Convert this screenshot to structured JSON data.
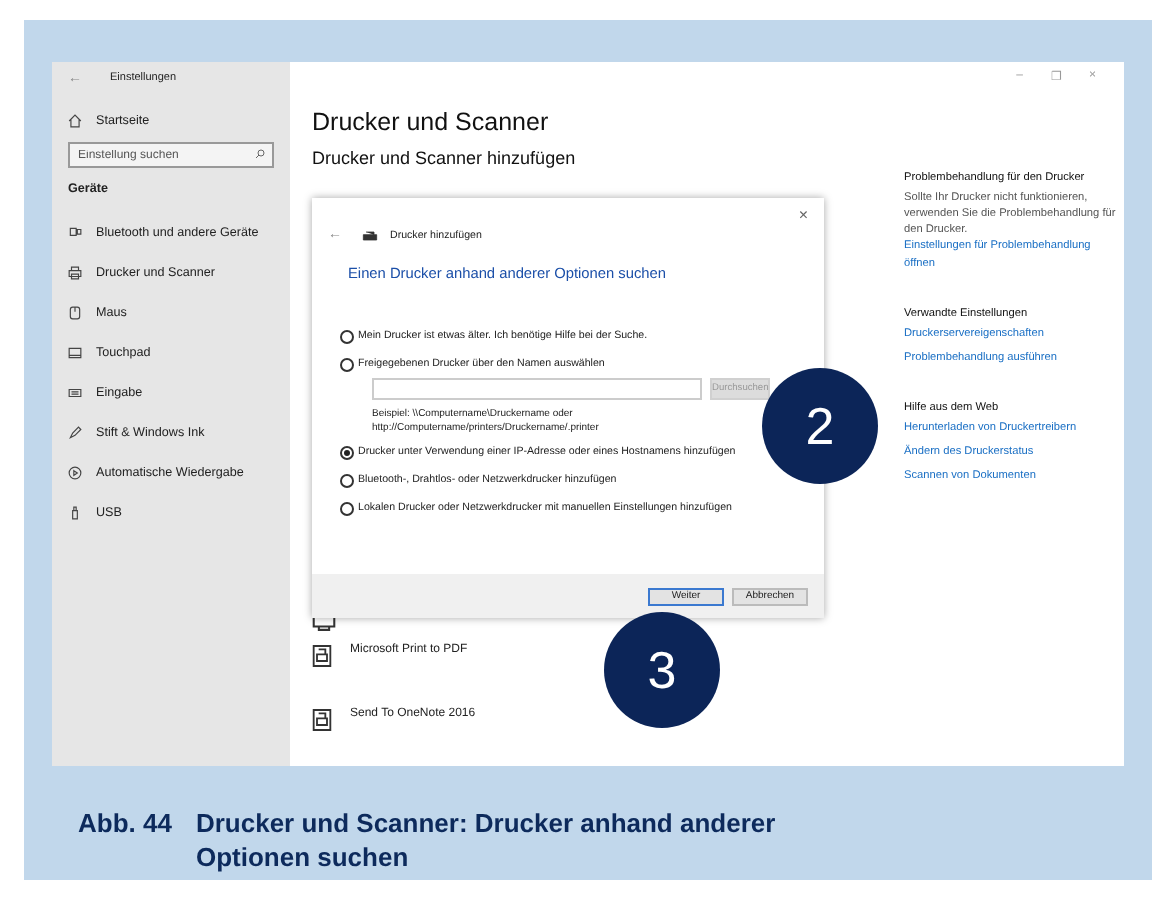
{
  "window": {
    "back": "←",
    "title": "Einstellungen",
    "controls": [
      "–",
      "❐",
      "×"
    ]
  },
  "sidebar": {
    "home": "Startseite",
    "search": {
      "placeholder": "Einstellung suchen"
    },
    "section": "Geräte",
    "items": [
      {
        "label": "Bluetooth und andere Geräte"
      },
      {
        "label": "Drucker und Scanner"
      },
      {
        "label": "Maus"
      },
      {
        "label": "Touchpad"
      },
      {
        "label": "Eingabe"
      },
      {
        "label": "Stift & Windows Ink"
      },
      {
        "label": "Automatische Wiedergabe"
      },
      {
        "label": "USB"
      }
    ]
  },
  "main": {
    "title": "Drucker und Scanner",
    "subtitle": "Drucker und Scanner hinzufügen",
    "printers": [
      "Microsoft Print to PDF",
      "Send To OneNote 2016"
    ]
  },
  "dialog": {
    "close": "×",
    "back": "←",
    "title": "Drucker hinzufügen",
    "heading": "Einen Drucker anhand anderer Optionen suchen",
    "options": [
      {
        "label": "Mein Drucker ist etwas älter. Ich benötige Hilfe bei der Suche.",
        "selected": false
      },
      {
        "label": "Freigegebenen Drucker über den Namen auswählen",
        "selected": false
      },
      {
        "label": "Drucker unter Verwendung einer IP-Adresse oder eines Hostnamens hinzufügen",
        "selected": true
      },
      {
        "label": "Bluetooth-, Drahtlos- oder Netzwerkdrucker hinzufügen",
        "selected": false
      },
      {
        "label": "Lokalen Drucker oder Netzwerkdrucker mit manuellen Einstellungen hinzufügen",
        "selected": false
      }
    ],
    "browse_button": {
      "label": "Durchsuchen",
      "disabled": true
    },
    "example": [
      "Beispiel: \\\\Computername\\Druckername oder",
      "http://Computername/printers/Druckername/.printer"
    ],
    "buttons": [
      {
        "label": "Weiter",
        "default": true
      },
      {
        "label": "Abbrechen",
        "default": false
      }
    ]
  },
  "help": [
    {
      "heading": "Problembehandlung für den Drucker",
      "text": "Sollte Ihr Drucker nicht funktionieren, verwenden Sie die Problembehandlung für den Drucker.",
      "links": [
        "Einstellungen für Problembehandlung öffnen"
      ]
    },
    {
      "heading": "Verwandte Einstellungen",
      "links": [
        "Druckerservereigenschaften",
        "Problembehandlung ausführen"
      ]
    },
    {
      "heading": "Hilfe aus dem Web",
      "links": [
        "Herunterladen von Druckertreibern",
        "Ändern des Druckerstatus",
        "Scannen von Dokumenten"
      ]
    }
  ],
  "badges": [
    "2",
    "3"
  ],
  "caption": {
    "number": "Abb. 44",
    "text": "Drucker und Scanner: Drucker anhand anderer Optionen suchen"
  }
}
